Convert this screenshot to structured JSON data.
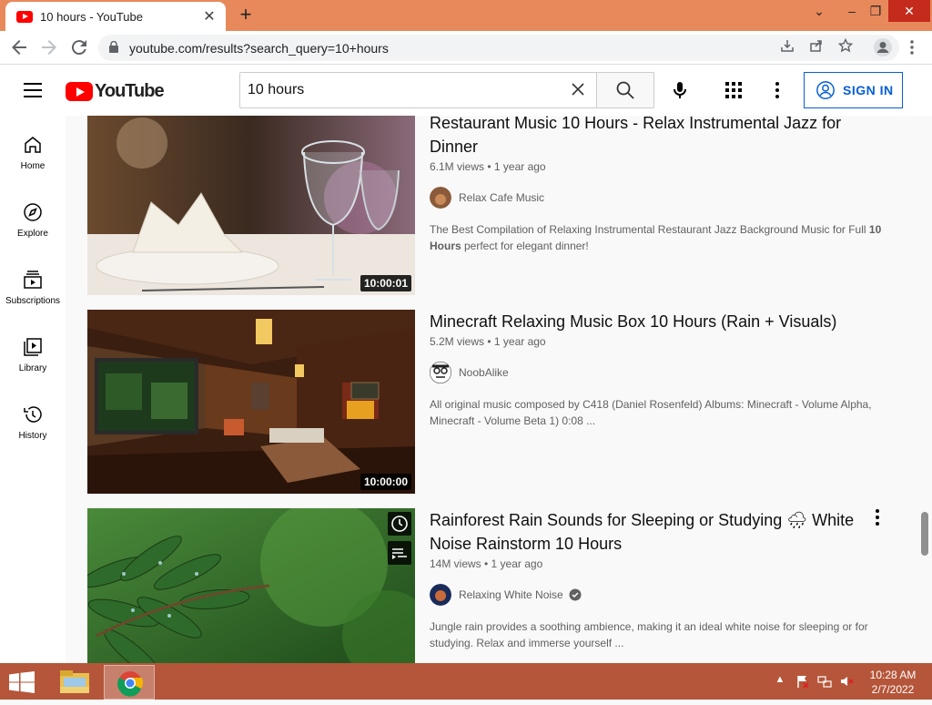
{
  "browser": {
    "tab_title": "10 hours - YouTube",
    "tab_close": "✕",
    "new_tab": "+",
    "url": "youtube.com/results?search_query=10+hours",
    "window_controls": {
      "dropdown": "⌄",
      "minimize": "–",
      "restore": "❐",
      "close": "✕"
    }
  },
  "youtube": {
    "logo_text": "YouTube",
    "search_value": "10 hours",
    "search_placeholder": "Search",
    "signin_label": "SIGN IN",
    "accent_color": "#065fd4",
    "brand_color": "#ff0000"
  },
  "guide": [
    {
      "label": "Home",
      "icon": "home-icon"
    },
    {
      "label": "Explore",
      "icon": "compass-icon"
    },
    {
      "label": "Subscriptions",
      "icon": "subscriptions-icon"
    },
    {
      "label": "Library",
      "icon": "library-icon"
    },
    {
      "label": "History",
      "icon": "history-icon"
    }
  ],
  "videos": [
    {
      "title": "Restaurant Music 10 Hours - Relax Instrumental Jazz for Dinner",
      "meta": "6.1M views • 1 year ago",
      "channel": "Relax Cafe Music",
      "description_pre": "The Best Compilation of Relaxing Instrumental Restaurant Jazz Background Music for Full ",
      "description_bold1": "10 Hours",
      "description_post": " perfect for elegant dinner!",
      "duration": "10:00:01"
    },
    {
      "title": "Minecraft Relaxing Music Box 10 Hours (Rain + Visuals)",
      "meta": "5.2M views • 1 year ago",
      "channel": "NoobAlike",
      "description": "All original music composed by C418 (Daniel Rosenfeld) Albums: Minecraft - Volume Alpha, Minecraft - Volume Beta 1) 0:08 ...",
      "duration": "10:00:00"
    },
    {
      "title": "Rainforest Rain Sounds for Sleeping or Studying 🌧 White Noise Rainstorm 10 Hours",
      "meta": "14M views • 1 year ago",
      "channel": "Relaxing White Noise",
      "verified": true,
      "description": "Jungle rain provides a soothing ambience, making it an ideal white noise for sleeping or for studying. Relax and immerse yourself ..."
    }
  ],
  "taskbar": {
    "time": "10:28 AM",
    "date": "2/7/2022",
    "tray_up": "▲"
  }
}
